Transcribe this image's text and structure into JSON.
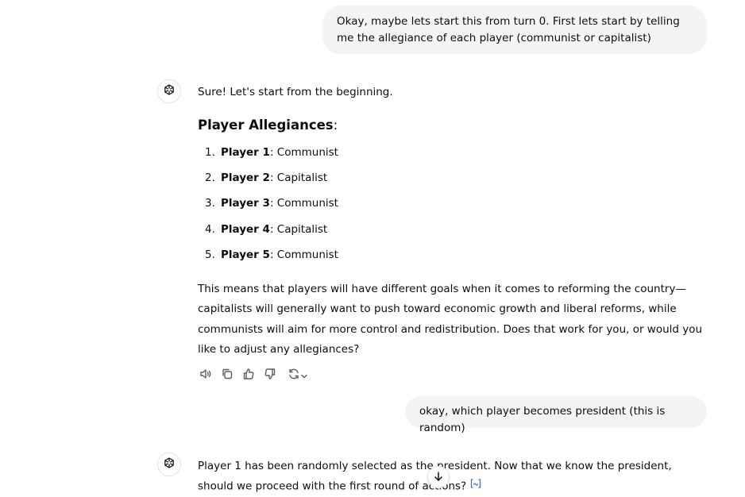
{
  "messages": {
    "user_1": "Okay, maybe lets start this from turn 0. First lets start by telling me the allegiance of each player (communist or capitalist)",
    "assistant_1": {
      "intro": "Sure! Let's start from the beginning.",
      "heading": "Player Allegiances",
      "heading_colon": ":",
      "players": [
        {
          "num": "1.",
          "name": "Player 1",
          "allegiance": ": Communist"
        },
        {
          "num": "2.",
          "name": "Player 2",
          "allegiance": ": Capitalist"
        },
        {
          "num": "3.",
          "name": "Player 3",
          "allegiance": ": Communist"
        },
        {
          "num": "4.",
          "name": "Player 4",
          "allegiance": ": Capitalist"
        },
        {
          "num": "5.",
          "name": "Player 5",
          "allegiance": ": Communist"
        }
      ],
      "paragraph": "This means that players will have different goals when it comes to reforming the country—capitalists will generally want to push toward economic growth and liberal reforms, while communists will aim for more control and redistribution. Does that work for you, or would you like to adjust any allegiances?"
    },
    "user_2": "okay, which player becomes president (this is random)",
    "assistant_2": "Player 1 has been randomly selected as the president. Now that we know the president, should we proceed with the first round of actions?"
  },
  "icons": {
    "avatar": "openai-logo-icon",
    "actions": [
      "read-aloud-icon",
      "copy-icon",
      "thumbs-up-icon",
      "thumbs-down-icon",
      "regenerate-icon"
    ],
    "source": "sources-icon",
    "scroll": "arrow-down-icon"
  },
  "colors": {
    "user_bubble": "#f4f4f4",
    "text": "#0d0d0d",
    "icon": "#5d5d5d"
  }
}
